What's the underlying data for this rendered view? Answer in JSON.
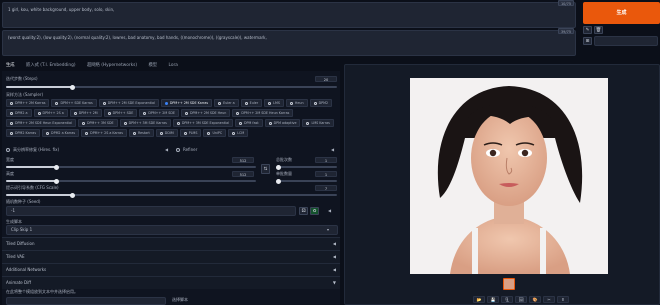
{
  "prompts": {
    "positive": "1 girl, kou, white background, upper body, solo, skin,",
    "positive_count": "10/75",
    "negative": "(worst quality:2), (low quality:2), (normal quality:2), lowres, bad anatomy, bad hands, ((monochrome)), ((grayscale)), watermark,",
    "negative_count": "39/75"
  },
  "generate_label": "生成",
  "tabs": [
    "生成",
    "嵌入式 (T.I. Embedding)",
    "超网络 (Hypernetworks)",
    "模型",
    "Lora"
  ],
  "steps": {
    "label": "迭代步数 (Steps)",
    "value": "20",
    "fraction": 0.2
  },
  "sampler": {
    "label": "采样方法 (Sampler)",
    "selected_index": 3,
    "options": [
      "DPM++ 2M Karras",
      "DPM++ SDE Karras",
      "DPM++ 2M SDE Exponential",
      "DPM++ 2M SDE Karras",
      "Euler a",
      "Euler",
      "LMS",
      "Heun",
      "DPM2",
      "DPM2 a",
      "DPM++ 2S a",
      "DPM++ 2M",
      "DPM++ SDE",
      "DPM++ 2M SDE",
      "DPM++ 2M SDE Heun",
      "DPM++ 2M SDE Heun Karras",
      "DPM++ 2M SDE Heun Exponential",
      "DPM++ 3M SDE",
      "DPM++ 3M SDE Karras",
      "DPM++ 3M SDE Exponential",
      "DPM fast",
      "DPM adaptive",
      "LMS Karras",
      "DPM2 Karras",
      "DPM2 a Karras",
      "DPM++ 2S a Karras",
      "Restart",
      "DDIM",
      "PLMS",
      "UniPC",
      "LCM"
    ]
  },
  "hires_fix": "高分辨率修复 (Hires. fix)",
  "refiner": "Refiner",
  "width": {
    "label": "宽度",
    "value": "512",
    "fraction": 0.2
  },
  "height": {
    "label": "高度",
    "value": "512",
    "fraction": 0.2
  },
  "batch_count": {
    "label": "总批次数",
    "value": "1",
    "fraction": 0.0
  },
  "batch_size": {
    "label": "单批数量",
    "value": "1",
    "fraction": 0.0
  },
  "cfg": {
    "label": "提示词引导系数 (CFG Scale)",
    "value": "7",
    "fraction": 0.2
  },
  "seed": {
    "label": "随机数种子 (Seed)",
    "value": "-1"
  },
  "script_section": {
    "label": "生成脚本",
    "selected": "Clip Skip 1"
  },
  "accordions": [
    "Tiled Diffusion",
    "Tiled VAE",
    "Additional Networks",
    "Animate Diff"
  ],
  "bottom_text": "在此将整个模组放到文本中并选择启用。",
  "bottom_right_label": "选择脚本",
  "tool_icons": [
    "✎",
    "🗑",
    "⤓",
    "⊞"
  ],
  "output_buttons": [
    "📂",
    "💾",
    "🗜",
    "🖼",
    "🎨",
    "✂",
    "⬆"
  ]
}
